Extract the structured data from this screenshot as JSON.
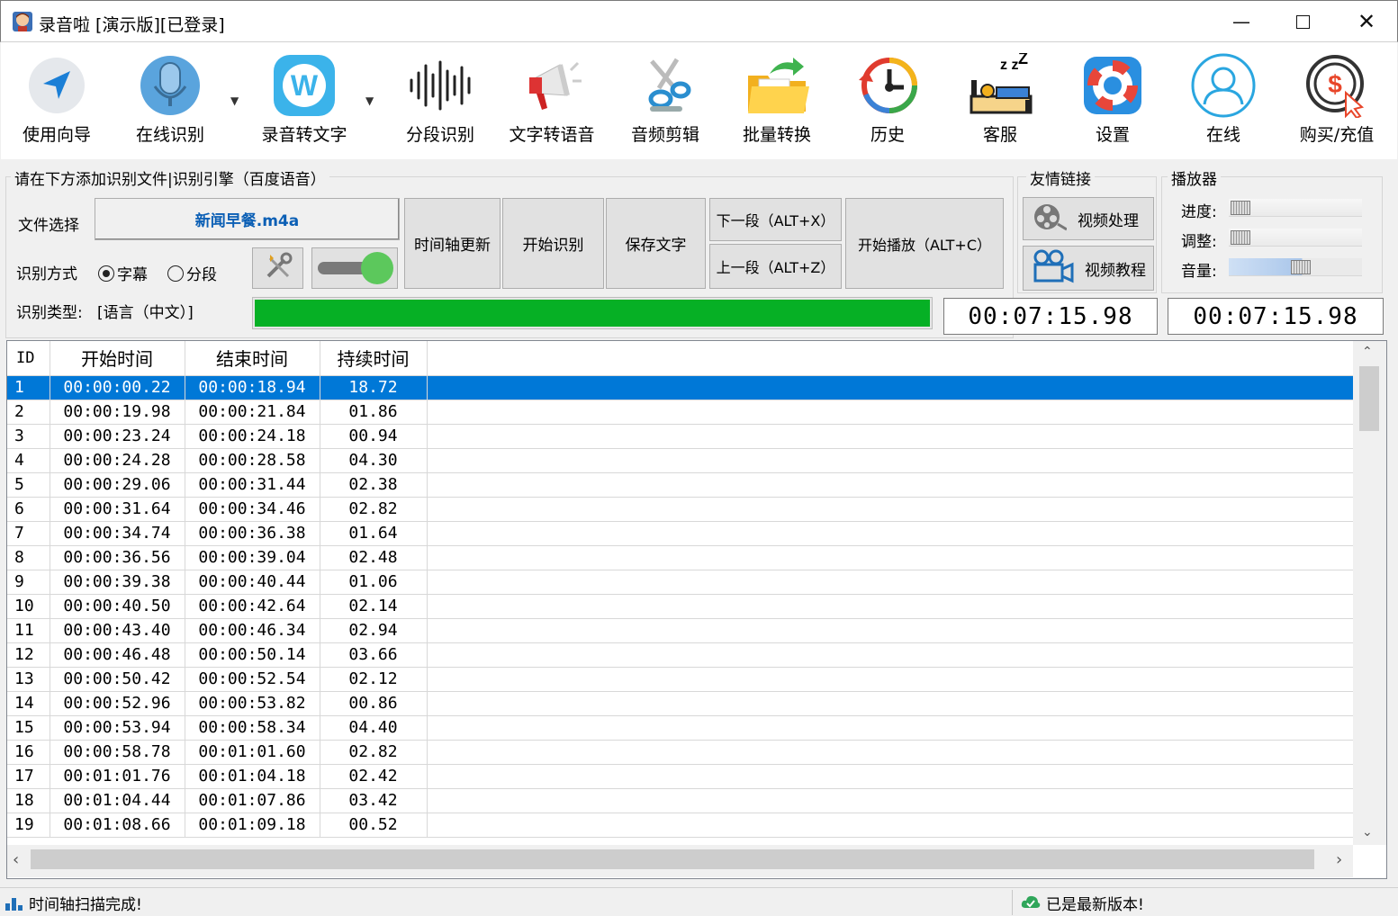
{
  "window": {
    "title": "录音啦 [演示版][已登录]"
  },
  "toolbar": [
    {
      "label": "使用向导",
      "icon": "navigation-arrow-icon"
    },
    {
      "label": "在线识别",
      "icon": "microphone-icon"
    },
    {
      "label": "录音转文字",
      "icon": "w-logo-icon"
    },
    {
      "label": "分段识别",
      "icon": "waveform-icon"
    },
    {
      "label": "文字转语音",
      "icon": "megaphone-icon"
    },
    {
      "label": "音频剪辑",
      "icon": "scissors-icon"
    },
    {
      "label": "批量转换",
      "icon": "folder-convert-icon"
    },
    {
      "label": "历史",
      "icon": "history-clock-icon"
    },
    {
      "label": "客服",
      "icon": "sleeping-bed-icon"
    },
    {
      "label": "设置",
      "icon": "lifebuoy-icon"
    },
    {
      "label": "在线",
      "icon": "user-circle-icon"
    },
    {
      "label": "购买/充值",
      "icon": "coin-cursor-icon"
    }
  ],
  "panel": {
    "group_title": "请在下方添加识别文件|识别引擎（百度语音）",
    "file_label": "文件选择",
    "file_name": "新闻早餐.m4a",
    "mode_label": "识别方式",
    "mode_options": [
      "字幕",
      "分段"
    ],
    "type_label": "识别类型:",
    "type_value": "[语言（中文）]",
    "progress": 1.0,
    "buttons": {
      "timeline": "时间轴更新",
      "start": "开始识别",
      "save": "保存文字",
      "next": "下一段（ALT+X）",
      "prev": "上一段（ALT+Z）",
      "play": "开始播放（ALT+C）"
    }
  },
  "links": {
    "title": "友情链接",
    "video_process": "视频处理",
    "video_tutorial": "视频教程"
  },
  "player": {
    "title": "播放器",
    "progress_label": "进度:",
    "adjust_label": "调整:",
    "volume_label": "音量:",
    "progress_value": 0.0,
    "adjust_value": 0.0,
    "volume_value": 0.55,
    "time_left": "00:07:15.98",
    "time_right": "00:07:15.98"
  },
  "table": {
    "headers": [
      "ID",
      "开始时间",
      "结束时间",
      "持续时间"
    ],
    "rows": [
      [
        "1",
        "00:00:00.22",
        "00:00:18.94",
        "18.72"
      ],
      [
        "2",
        "00:00:19.98",
        "00:00:21.84",
        "01.86"
      ],
      [
        "3",
        "00:00:23.24",
        "00:00:24.18",
        "00.94"
      ],
      [
        "4",
        "00:00:24.28",
        "00:00:28.58",
        "04.30"
      ],
      [
        "5",
        "00:00:29.06",
        "00:00:31.44",
        "02.38"
      ],
      [
        "6",
        "00:00:31.64",
        "00:00:34.46",
        "02.82"
      ],
      [
        "7",
        "00:00:34.74",
        "00:00:36.38",
        "01.64"
      ],
      [
        "8",
        "00:00:36.56",
        "00:00:39.04",
        "02.48"
      ],
      [
        "9",
        "00:00:39.38",
        "00:00:40.44",
        "01.06"
      ],
      [
        "10",
        "00:00:40.50",
        "00:00:42.64",
        "02.14"
      ],
      [
        "11",
        "00:00:43.40",
        "00:00:46.34",
        "02.94"
      ],
      [
        "12",
        "00:00:46.48",
        "00:00:50.14",
        "03.66"
      ],
      [
        "13",
        "00:00:50.42",
        "00:00:52.54",
        "02.12"
      ],
      [
        "14",
        "00:00:52.96",
        "00:00:53.82",
        "00.86"
      ],
      [
        "15",
        "00:00:53.94",
        "00:00:58.34",
        "04.40"
      ],
      [
        "16",
        "00:00:58.78",
        "00:01:01.60",
        "02.82"
      ],
      [
        "17",
        "00:01:01.76",
        "00:01:04.18",
        "02.42"
      ],
      [
        "18",
        "00:01:04.44",
        "00:01:07.86",
        "03.42"
      ],
      [
        "19",
        "00:01:08.66",
        "00:01:09.18",
        "00.52"
      ]
    ]
  },
  "status": {
    "left": "时间轴扫描完成!",
    "right": "已是最新版本!"
  },
  "colors": {
    "selection": "#0078d7",
    "progress": "#06b025",
    "toggle": "#5cc85c"
  }
}
